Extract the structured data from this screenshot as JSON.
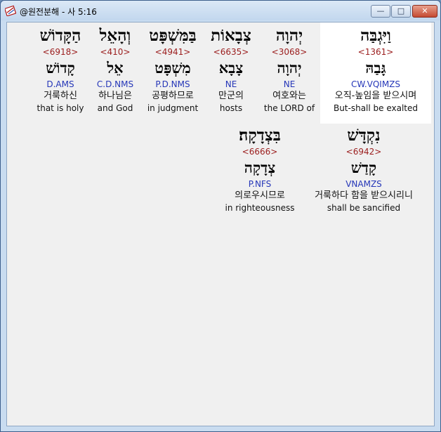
{
  "window": {
    "title": "@원전분해 - 사 5:16"
  },
  "buttons": {
    "minimize": "—",
    "maximize": "□",
    "close": "✕"
  },
  "row1": [
    {
      "hebrew": "וַיִּגְבַּה",
      "strong": "<1361>",
      "lemma": "גָּבַהּ",
      "morph": "CW.VQIMZS",
      "korean": "오직-높임을 받으시며",
      "english": "But-shall be exalted",
      "highlight": true
    },
    {
      "hebrew": "יְהוָה",
      "strong": "<3068>",
      "lemma": "יְהוָה",
      "morph": "NE",
      "korean": "여호와는",
      "english": "the LORD of"
    },
    {
      "hebrew": "צְבָאוֹת",
      "strong": "<6635>",
      "lemma": "צָבָא",
      "morph": "NE",
      "korean": "만군의",
      "english": "hosts"
    },
    {
      "hebrew": "בַּמִּשְׁפָּט",
      "strong": "<4941>",
      "lemma": "מִשְׁפָּט",
      "morph": "P.D.NMS",
      "korean": "공평하므로",
      "english": "in judgment"
    },
    {
      "hebrew": "וְהָאֵל",
      "strong": "<410>",
      "lemma": "אֵל",
      "morph": "C.D.NMS",
      "korean": "하나님은",
      "english": "and God"
    },
    {
      "hebrew": "הַקָּדוֹשׁ",
      "strong": "<6918>",
      "lemma": "קָדוֹשׁ",
      "morph": "D.AMS",
      "korean": "거룩하신",
      "english": "that is holy"
    }
  ],
  "row2": [
    {
      "hebrew": "נִקְדָּשׁ",
      "strong": "<6942>",
      "lemma": "קָדַשׁ",
      "morph": "VNAMZS",
      "korean": "거룩하다 함을 받으시리니",
      "english": "shall be sancified"
    },
    {
      "hebrew": "בִּצְדָקָה׃",
      "strong": "<6666>",
      "lemma": "צְדָקָה",
      "morph": "P.NFS",
      "korean": "의로우시므로",
      "english": "in righteousness"
    }
  ]
}
